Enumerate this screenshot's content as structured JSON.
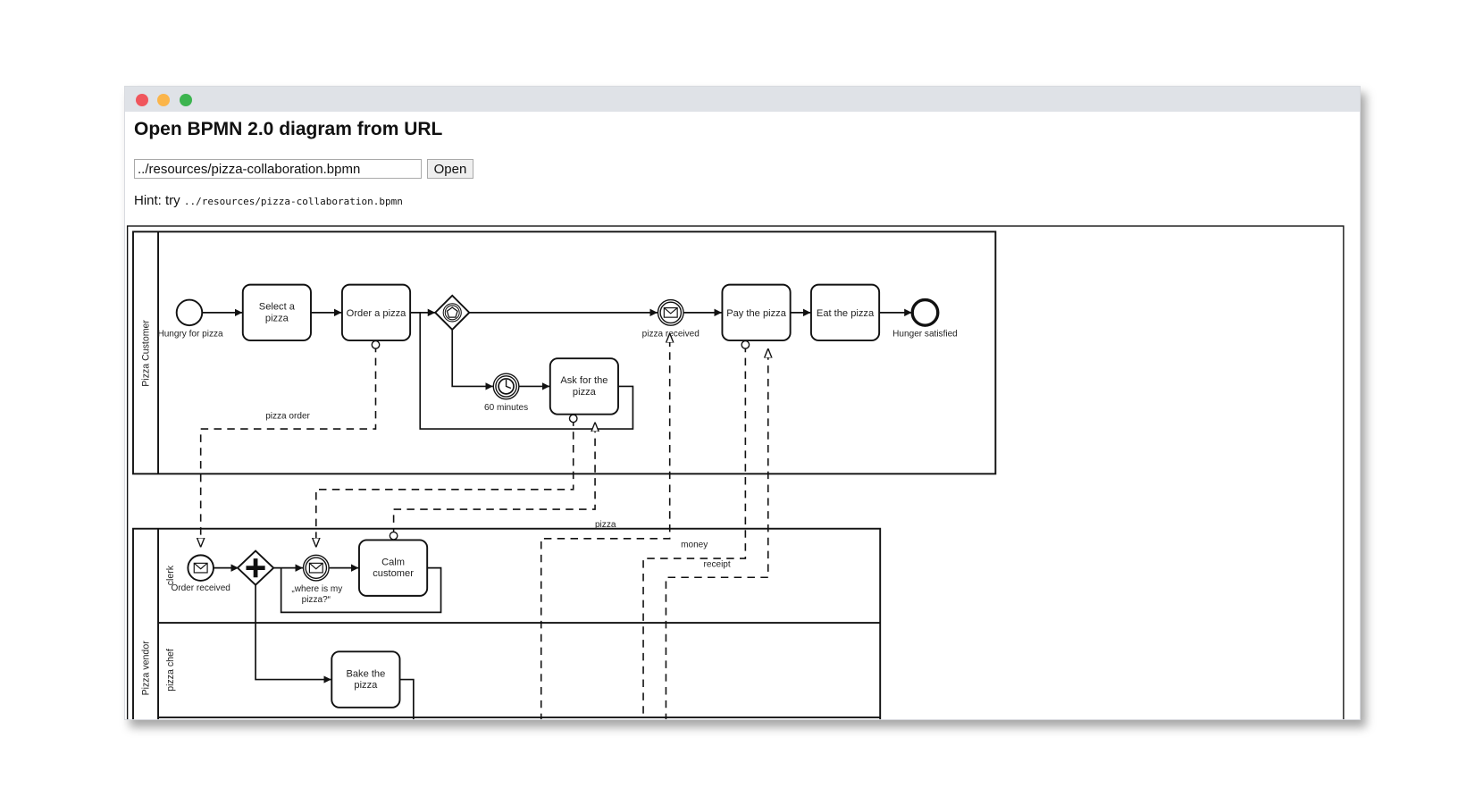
{
  "window": {
    "controls": [
      "close",
      "minimize",
      "maximize"
    ]
  },
  "page": {
    "title": "Open BPMN 2.0 diagram from URL",
    "url_input_value": "../resources/pizza-collaboration.bpmn",
    "open_button": "Open",
    "hint_prefix": "Hint: try ",
    "hint_code": "../resources/pizza-collaboration.bpmn"
  },
  "diagram": {
    "pools": [
      {
        "name": "Pizza Customer",
        "lanes": []
      },
      {
        "name": "Pizza vendor",
        "lanes": [
          "clerk",
          "pizza chef"
        ]
      }
    ],
    "customer": {
      "start_event": "Hungry for pizza",
      "task_select": [
        "Select a",
        "pizza"
      ],
      "task_order": "Order a pizza",
      "event_gateway": "event-based-gateway",
      "timer_event": "60 minutes",
      "task_ask": [
        "Ask for the",
        "pizza"
      ],
      "message_event": "pizza received",
      "task_pay": "Pay the pizza",
      "task_eat": "Eat the pizza",
      "end_event": "Hunger satisfied"
    },
    "vendor": {
      "start_event": "Order received",
      "parallel_gateway": "parallel-gateway",
      "message_event": [
        "„where is my",
        "pizza?“"
      ],
      "task_calm": [
        "Calm",
        "customer"
      ],
      "task_bake": [
        "Bake the",
        "pizza"
      ]
    },
    "message_flows": {
      "pizza_order": "pizza order",
      "pizza": "pizza",
      "money": "money",
      "receipt": "receipt"
    }
  }
}
